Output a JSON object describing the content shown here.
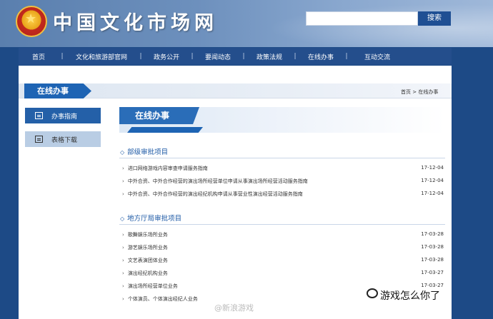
{
  "header": {
    "site_title": "中国文化市场网",
    "search_button": "搜索",
    "search_placeholder": ""
  },
  "nav": {
    "items": [
      "首页",
      "文化和旅游部官网",
      "政务公开",
      "要闻动态",
      "政策法规",
      "在线办事",
      "互动交流"
    ],
    "separator": "|"
  },
  "section": {
    "title": "在线办事",
    "breadcrumb": "首页 > 在线办事"
  },
  "sidebar": {
    "items": [
      {
        "label": "办事指南",
        "active": true
      },
      {
        "label": "表格下载",
        "active": false
      }
    ]
  },
  "main": {
    "banner_title": "在线办事",
    "groups": [
      {
        "title": "部级审批项目",
        "rows": [
          {
            "text": "进口网络游戏内容审查申请服务指南",
            "date": "17-12-04"
          },
          {
            "text": "中外合资、中外合作经营的演出场所经营单位申请从事演出场所经营活动服务指南",
            "date": "17-12-04"
          },
          {
            "text": "中外合资、中外合作经营的演出经纪机构申请从事营业性演出经营活动服务指南",
            "date": "17-12-04"
          }
        ]
      },
      {
        "title": "地方厅局审批项目",
        "rows": [
          {
            "text": "歌舞娱乐场所业务",
            "date": "17-03-28"
          },
          {
            "text": "游艺娱乐场所业务",
            "date": "17-03-28"
          },
          {
            "text": "文艺表演团体业务",
            "date": "17-03-28"
          },
          {
            "text": "演出经纪机构业务",
            "date": "17-03-27"
          },
          {
            "text": "演出场所经营单位业务",
            "date": "17-03-27"
          },
          {
            "text": "个体演员、个体演出经纪人业务",
            "date": ""
          }
        ]
      }
    ]
  },
  "watermark": {
    "center": "@新浪游戏",
    "right": "游戏怎么你了"
  },
  "colors": {
    "nav_bg": "#244e8c",
    "accent": "#1e64b4",
    "link_title": "#1e5aa6"
  }
}
